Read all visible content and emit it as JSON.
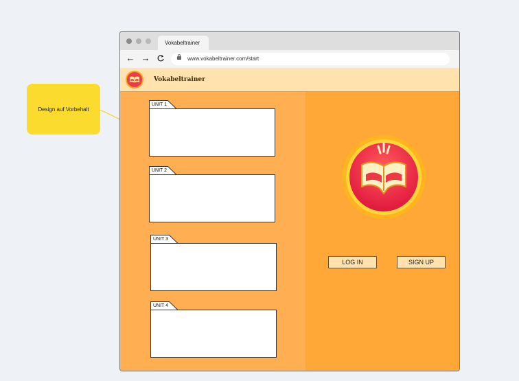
{
  "annotation": {
    "text": "Design auf Vorbehalt"
  },
  "browser": {
    "tab_title": "Vokabeltrainer",
    "url": "www.vokabeltrainer.com/start",
    "nav": {
      "back": "←",
      "forward": "→",
      "reload": "C"
    }
  },
  "app": {
    "title": "Vokabeltrainer"
  },
  "units": [
    {
      "label": "UNIT 1"
    },
    {
      "label": "UNIT 2"
    },
    {
      "label": "UNIT 3"
    },
    {
      "label": "UNIT 4"
    }
  ],
  "auth": {
    "login_label": "LOG IN",
    "signup_label": "SIGN UP"
  },
  "colors": {
    "header_bg": "#ffe2ad",
    "left_panel": "#ffae52",
    "right_panel": "#ffa737",
    "note": "#fcdb2f",
    "logo_red": "#f0304a",
    "logo_yellow": "#ffd22e"
  },
  "icons": [
    "back-arrow-icon",
    "forward-arrow-icon",
    "reload-icon",
    "lock-icon",
    "book-logo-icon"
  ]
}
